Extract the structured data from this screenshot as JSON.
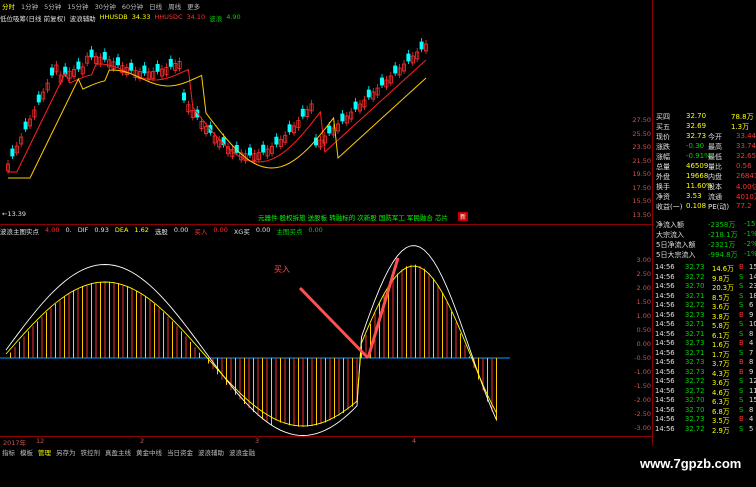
{
  "topbar": {
    "items": [
      "分时",
      "1分钟",
      "5分钟",
      "15分钟",
      "30分钟",
      "60分钟",
      "日线",
      "周线",
      "更多"
    ],
    "active": 0
  },
  "indicator_line": {
    "label": "低位吸筹(日线 前复权)",
    "label2": "波浪辅助",
    "ma1_label": "HHUSDB",
    "ma1_val": "34.33",
    "ma2_label": "HHUSDC",
    "ma2_val": "34.10",
    "sig_label": "波浪",
    "sig_val": "4.90"
  },
  "price_axis": [
    "27.50",
    "25.50",
    "23.50",
    "21.50",
    "19.50",
    "17.50",
    "15.50",
    "13.50"
  ],
  "low_mark": "←13.39",
  "concepts": {
    "text": "元器件 股权拆旅 送股板 转融标的 次新股 国防军工 军民融合 芯片",
    "tag": "新"
  },
  "macd_head": {
    "name": "波浪主图实点",
    "v1": "4.00",
    "v2": "0.",
    "dif_label": "DIF",
    "dif": "0.93",
    "dea_label": "DEA",
    "dea": "1.62",
    "select_label": "选股",
    "select_val": "0.00",
    "buy_label": "买入",
    "buy_val": "0.00",
    "xg_label": "XG买",
    "xg_val": "0.00",
    "main_label": "主图买点",
    "main_val": "0.00"
  },
  "macd_axis": [
    "3.00",
    "2.50",
    "2.00",
    "1.50",
    "1.00",
    "0.50",
    "0.00",
    "-0.50",
    "-1.00",
    "-1.50",
    "-2.00",
    "-2.50",
    "-3.00"
  ],
  "annotation": "买入",
  "date_axis": [
    "2017年",
    "12",
    "2",
    "3",
    "4"
  ],
  "bottom_tabs": {
    "items": [
      "指标",
      "模板",
      "管理",
      "另存为",
      "铁控剂",
      "真盈主线",
      "黄金中线",
      "当日资金",
      "波浪辅助",
      "波浪金融"
    ],
    "active": 2
  },
  "quote": {
    "rows": [
      {
        "k": "买四",
        "v": "32.70",
        "v2": "78.8万"
      },
      {
        "k": "买五",
        "v": "32.69",
        "v2": "1.3万"
      },
      {
        "k": "现价",
        "v": "32.73",
        "k2": "今开",
        "v3": "33.44"
      },
      {
        "k": "涨跌",
        "v": "-0.30",
        "k2": "最高",
        "v3": "33.74"
      },
      {
        "k": "涨幅",
        "v": "-0.91%",
        "k2": "最低",
        "v3": "32.65"
      },
      {
        "k": "总量",
        "v": "46509",
        "k2": "量比",
        "v3": "0.56"
      },
      {
        "k": "外盘",
        "v": "19668",
        "k2": "内盘",
        "v3": "26841"
      },
      {
        "k": "换手",
        "v": "11.60%",
        "k2": "股本",
        "v3": "4.00亿"
      },
      {
        "k": "净资",
        "v": "3.53",
        "k2": "流通",
        "v3": "4010万"
      },
      {
        "k": "收益(一)",
        "v": "0.108",
        "k2": "PE(动)",
        "v3": "77.2"
      }
    ],
    "flows": [
      {
        "k": "净流入额",
        "v": "-2358万",
        "p": "-15%"
      },
      {
        "k": "大宗流入",
        "v": "-218.1万",
        "p": "-1%"
      },
      {
        "k": "5日净流入额",
        "v": "-2321万",
        "p": "-2%"
      },
      {
        "k": "5日大宗流入",
        "v": "-994.8万",
        "p": "-1%"
      }
    ]
  },
  "ticks": [
    {
      "t": "14:56",
      "p": "32.73",
      "v": "14.6万",
      "s": "B",
      "n": "15"
    },
    {
      "t": "14:56",
      "p": "32.72",
      "v": "9.8万",
      "s": "S",
      "n": "14"
    },
    {
      "t": "14:56",
      "p": "32.70",
      "v": "20.3万",
      "s": "S",
      "n": "23"
    },
    {
      "t": "14:56",
      "p": "32.71",
      "v": "8.5万",
      "s": "S",
      "n": "18"
    },
    {
      "t": "14:56",
      "p": "32.72",
      "v": "3.6万",
      "s": "S",
      "n": "6"
    },
    {
      "t": "14:56",
      "p": "32.73",
      "v": "3.8万",
      "s": "B",
      "n": "9"
    },
    {
      "t": "14:56",
      "p": "32.71",
      "v": "5.8万",
      "s": "S",
      "n": "10"
    },
    {
      "t": "14:56",
      "p": "32.71",
      "v": "6.1万",
      "s": "S",
      "n": "8"
    },
    {
      "t": "14:56",
      "p": "32.73",
      "v": "1.6万",
      "s": "B",
      "n": "4"
    },
    {
      "t": "14:56",
      "p": "32.71",
      "v": "1.7万",
      "s": "S",
      "n": "7"
    },
    {
      "t": "14:56",
      "p": "32.73",
      "v": "3.7万",
      "s": "B",
      "n": "8"
    },
    {
      "t": "14:56",
      "p": "32.73",
      "v": "4.3万",
      "s": "B",
      "n": "9"
    },
    {
      "t": "14:56",
      "p": "32.72",
      "v": "3.6万",
      "s": "S",
      "n": "12"
    },
    {
      "t": "14:56",
      "p": "32.72",
      "v": "4.6万",
      "s": "S",
      "n": "11"
    },
    {
      "t": "14:56",
      "p": "32.70",
      "v": "6.3万",
      "s": "S",
      "n": "15"
    },
    {
      "t": "14:56",
      "p": "32.70",
      "v": "6.8万",
      "s": "S",
      "n": "8"
    },
    {
      "t": "14:56",
      "p": "32.73",
      "v": "3.5万",
      "s": "B",
      "n": "4"
    },
    {
      "t": "14:56",
      "p": "32.72",
      "v": "2.9万",
      "s": "S",
      "n": "5"
    }
  ],
  "watermark": "www.7gpzb.com",
  "colors": {
    "up": "#ff3030",
    "down": "#00ffff",
    "ma_fast": "#ff2020",
    "ma_slow": "#ffcc00",
    "grid": "#8b0000"
  }
}
